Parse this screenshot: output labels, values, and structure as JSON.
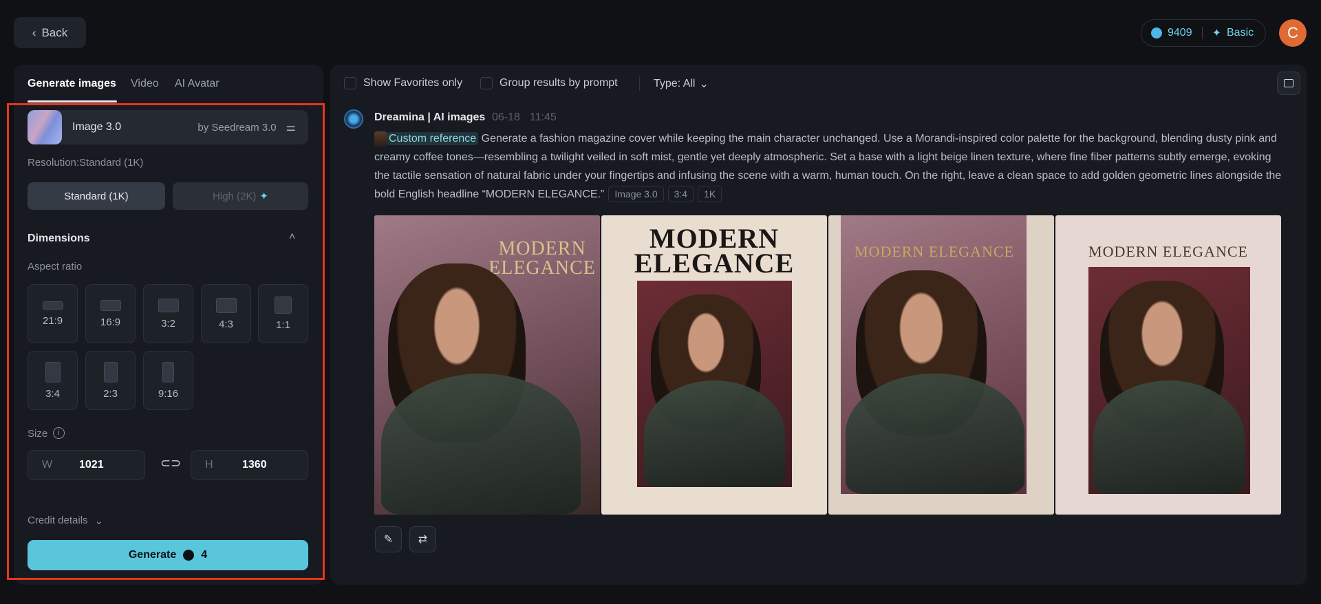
{
  "header": {
    "back_label": "Back",
    "credits": "9409",
    "plan": "Basic",
    "avatar_initial": "C"
  },
  "left": {
    "tabs": [
      "Generate images",
      "Video",
      "AI Avatar"
    ],
    "model": {
      "name": "Image 3.0",
      "provider": "by Seedream 3.0"
    },
    "resolution_label": "Resolution:Standard (1K)",
    "resolution_options": [
      "Standard (1K)",
      "High (2K)"
    ],
    "dimensions_label": "Dimensions",
    "aspect_ratio_label": "Aspect ratio",
    "aspect_ratios": [
      "21:9",
      "16:9",
      "3:2",
      "4:3",
      "1:1",
      "3:4",
      "2:3",
      "9:16"
    ],
    "size_label": "Size",
    "width_key": "W",
    "width": "1021",
    "height_key": "H",
    "height": "1360",
    "credit_details": "Credit details",
    "generate_label": "Generate",
    "generate_cost": "4"
  },
  "toolbar": {
    "favorites": "Show Favorites only",
    "group": "Group results by prompt",
    "type": "Type: All"
  },
  "result": {
    "source": "Dreamina | AI images",
    "date": "06-18",
    "time": "11:45",
    "ref_label": "Custom reference",
    "prompt": "Generate a fashion magazine cover while keeping the main character unchanged. Use a Morandi-inspired color palette for the background, blending dusty pink and creamy coffee tones—resembling a twilight veiled in soft mist, gentle yet deeply atmospheric. Set a base with a light beige linen texture, where fine fiber patterns subtly emerge, evoking the tactile sensation of natural fabric under your fingertips and infusing the scene with a warm, human touch. On the right, leave a clean space to add golden geometric lines alongside the bold English headline “MODERN ELEGANCE.”",
    "tags": [
      "Image 3.0",
      "3:4",
      "1K"
    ],
    "images": [
      {
        "headline": "MODERN ELEGANCE"
      },
      {
        "headline": "MODERN ELEGANCE"
      },
      {
        "headline": "MODERN ELEGANCE"
      },
      {
        "headline": "MODERN ELEGANCE"
      }
    ]
  },
  "colors": {
    "accent": "#5ac6db",
    "avatar": "#e06a33",
    "highlight": "#e8341c"
  }
}
